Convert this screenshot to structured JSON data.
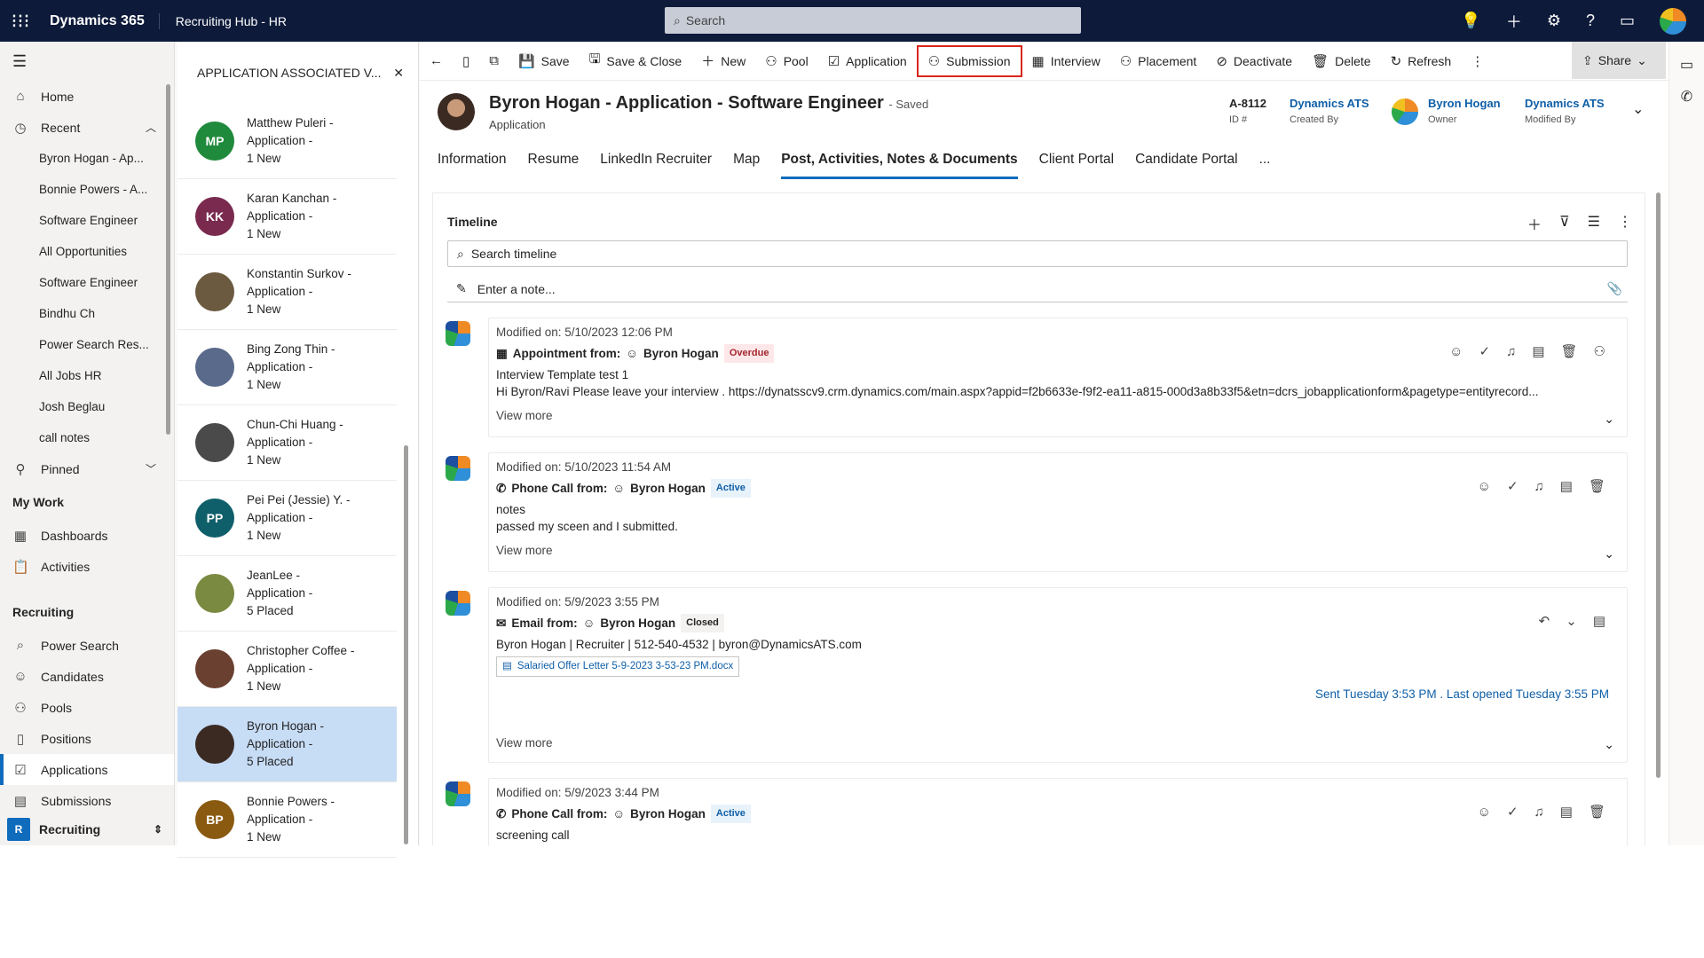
{
  "topbar": {
    "app": "Dynamics 365",
    "hub": "Recruiting Hub - HR",
    "search_placeholder": "Search"
  },
  "nav": {
    "home": "Home",
    "recent": "Recent",
    "recent_items": [
      "Byron Hogan - Ap...",
      "Bonnie Powers - A...",
      "Software Engineer",
      "All Opportunities",
      "Software Engineer",
      "Bindhu Ch",
      "Power Search Res...",
      "All Jobs HR",
      "Josh Beglau",
      "call notes"
    ],
    "pinned": "Pinned",
    "mywork": "My Work",
    "dashboards": "Dashboards",
    "activities": "Activities",
    "recruiting": "Recruiting",
    "power_search": "Power Search",
    "candidates": "Candidates",
    "pools": "Pools",
    "positions": "Positions",
    "applications": "Applications",
    "submissions": "Submissions",
    "area": "Recruiting",
    "area_letter": "R"
  },
  "panel": {
    "title": "APPLICATION ASSOCIATED V...",
    "rows": [
      {
        "initials": "MP",
        "name": "Matthew Puleri -",
        "line2": "Application -",
        "line3": "1 New",
        "color": "#1f8a3c"
      },
      {
        "initials": "KK",
        "name": "Karan Kanchan -",
        "line2": "Application -",
        "line3": "1 New",
        "color": "#7a2a4f"
      },
      {
        "initials": "",
        "name": "Konstantin Surkov -",
        "line2": "Application -",
        "line3": "1 New",
        "color": "#6b5a40"
      },
      {
        "initials": "",
        "name": "Bing Zong Thin -",
        "line2": "Application -",
        "line3": "1 New",
        "color": "#5a6a8a"
      },
      {
        "initials": "",
        "name": "Chun-Chi Huang -",
        "line2": "Application -",
        "line3": "1 New",
        "color": "#4a4a4a"
      },
      {
        "initials": "PP",
        "name": "Pei Pei (Jessie) Y. -",
        "line2": "Application -",
        "line3": "1 New",
        "color": "#0f5f6a"
      },
      {
        "initials": "",
        "name": "JeanLee -",
        "line2": "Application -",
        "line3": "5 Placed",
        "color": "#7a8a40"
      },
      {
        "initials": "",
        "name": "Christopher Coffee -",
        "line2": "Application -",
        "line3": "1 New",
        "color": "#6a4030"
      },
      {
        "initials": "",
        "name": "Byron Hogan -",
        "line2": "Application -",
        "line3": "5 Placed",
        "color": "#3a2a22"
      },
      {
        "initials": "BP",
        "name": "Bonnie Powers -",
        "line2": "Application -",
        "line3": "1 New",
        "color": "#8a5a10"
      }
    ]
  },
  "cmd": {
    "save": "Save",
    "save_close": "Save & Close",
    "new": "New",
    "pool": "Pool",
    "application": "Application",
    "submission": "Submission",
    "interview": "Interview",
    "placement": "Placement",
    "deactivate": "Deactivate",
    "delete": "Delete",
    "refresh": "Refresh",
    "share": "Share"
  },
  "header": {
    "title": "Byron Hogan - Application - Software Engineer",
    "saved": "- Saved",
    "entity": "Application",
    "id_value": "A-8112",
    "id_label": "ID #",
    "created_by": "Dynamics ATS",
    "created_by_label": "Created By",
    "owner": "Byron Hogan",
    "owner_label": "Owner",
    "modified_by": "Dynamics ATS",
    "modified_by_label": "Modified By"
  },
  "tabs": [
    "Information",
    "Resume",
    "LinkedIn Recruiter",
    "Map",
    "Post, Activities, Notes & Documents",
    "Client Portal",
    "Candidate Portal",
    "..."
  ],
  "timeline": {
    "title": "Timeline",
    "search_placeholder": "Search timeline",
    "note_placeholder": "Enter a note...",
    "cards": [
      {
        "modified": "Modified on: 5/10/2023 12:06 PM",
        "type": "Appointment from:",
        "who": "Byron Hogan",
        "status": "Overdue",
        "line1": "Interview Template test 1",
        "line2": "Hi Byron/Ravi Please leave your interview .   https://dynatsscv9.crm.dynamics.com/main.aspx?appid=f2b6633e-f9f2-ea11-a815-000d3a8b33f5&etn=dcrs_jobapplicationform&pagetype=entityrecord...",
        "more": "View more"
      },
      {
        "modified": "Modified on: 5/10/2023 11:54 AM",
        "type": "Phone Call from:",
        "who": "Byron Hogan",
        "status": "Active",
        "line1": "notes",
        "line2": "passed my sceen and I submitted.",
        "more": "View more"
      },
      {
        "modified": "Modified on: 5/9/2023 3:55 PM",
        "type": "Email from:",
        "who": "Byron Hogan",
        "status": "Closed",
        "line1": "Byron Hogan | Recruiter | 512-540-4532 | byron@DynamicsATS.com",
        "attachment": "Salaried Offer Letter 5-9-2023 3-53-23 PM.docx",
        "sent": "Sent Tuesday 3:53 PM . Last opened Tuesday 3:55 PM",
        "more": "View more"
      },
      {
        "modified": "Modified on: 5/9/2023 3:44 PM",
        "type": "Phone Call from:",
        "who": "Byron Hogan",
        "status": "Active",
        "line1": "screening call"
      }
    ]
  }
}
